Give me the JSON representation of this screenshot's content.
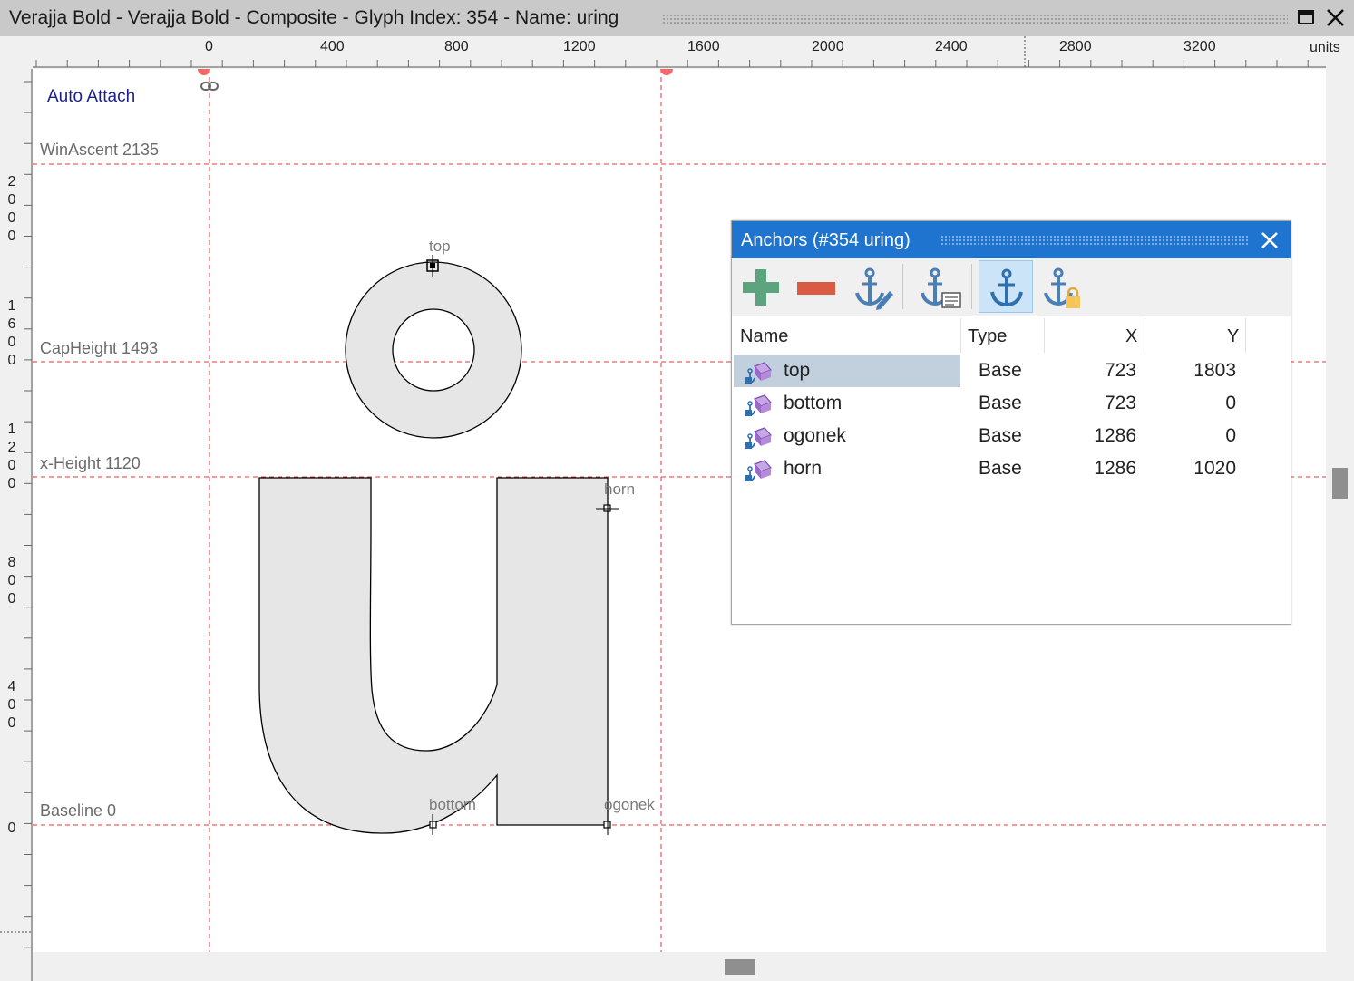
{
  "window": {
    "title": "Verajja Bold - Verajja Bold - Composite - Glyph Index: 354 - Name: uring"
  },
  "ruler_top": {
    "labels": [
      "0",
      "400",
      "800",
      "1200",
      "1600",
      "2000",
      "2400",
      "2800",
      "3200"
    ],
    "units_label": "units"
  },
  "ruler_left": {
    "labels": [
      "2000",
      "1600",
      "1200",
      "800",
      "400",
      "0"
    ]
  },
  "canvas": {
    "auto_attach": "Auto Attach",
    "metrics": {
      "win_ascent": "WinAscent 2135",
      "cap_height": "CapHeight 1493",
      "x_height": "x-Height 1120",
      "baseline": "Baseline 0"
    },
    "anchor_labels": {
      "top": "top",
      "horn": "horn",
      "bottom": "bottom",
      "ogonek": "ogonek"
    },
    "colors": {
      "guide": "#e0383b",
      "glyph_fill": "#e6e6e6",
      "glyph_stroke": "#000000"
    }
  },
  "anchors_panel": {
    "title": "Anchors (#354 uring)",
    "toolbar": {
      "add": "add-icon",
      "remove": "remove-icon",
      "edit": "anchor-edit-icon",
      "properties": "anchor-properties-icon",
      "show_anchors": "anchor-icon",
      "lock": "anchor-lock-icon"
    },
    "columns": {
      "name": "Name",
      "type": "Type",
      "x": "X",
      "y": "Y"
    },
    "rows": [
      {
        "name": "top",
        "type": "Base",
        "x": "723",
        "y": "1803",
        "selected": true
      },
      {
        "name": "bottom",
        "type": "Base",
        "x": "723",
        "y": "0",
        "selected": false
      },
      {
        "name": "ogonek",
        "type": "Base",
        "x": "1286",
        "y": "0",
        "selected": false
      },
      {
        "name": "horn",
        "type": "Base",
        "x": "1286",
        "y": "1020",
        "selected": false
      }
    ]
  }
}
